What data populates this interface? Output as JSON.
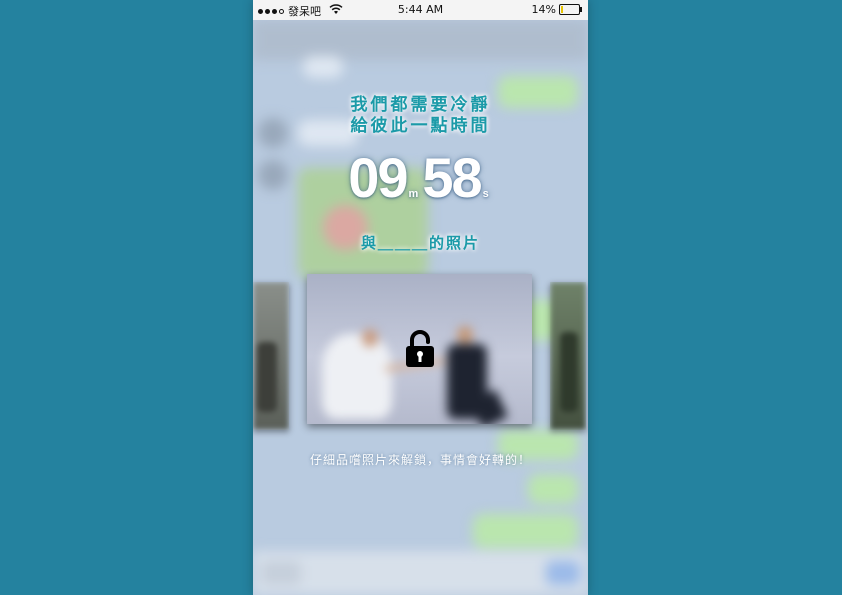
{
  "status_bar": {
    "carrier": "發呆吧",
    "time": "5:44 AM",
    "battery": "14%",
    "battery_level": 0.14
  },
  "headline": {
    "line1": "我們都需要冷靜",
    "line2": "給彼此一點時間"
  },
  "countdown": {
    "minutes": "09",
    "minutes_unit": "m",
    "seconds": "58",
    "seconds_unit": "s"
  },
  "photo_title": "與＿＿＿的照片",
  "photo": {
    "lock_icon": "padlock-icon"
  },
  "hint": "仔細品嚐照片來解鎖，事情會好轉的！",
  "colors": {
    "page_background": "#24829f",
    "accent_text": "#1b9aa8",
    "chat_bubble_green": "#b8ec9a"
  }
}
